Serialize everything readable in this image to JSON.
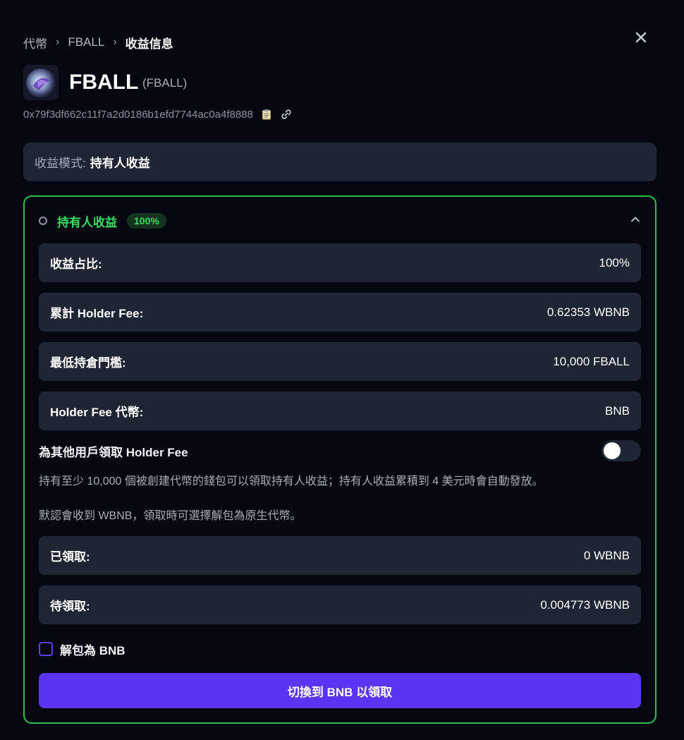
{
  "breadcrumb": {
    "items": [
      "代幣",
      "FBALL"
    ],
    "current": "收益信息",
    "separator": "›"
  },
  "token": {
    "name": "FBALL",
    "symbol": "(FBALL)",
    "address": "0x79f3df662c11f7a2d0186b1efd7744ac0a4f8888",
    "logo_icon": "token-logo-image"
  },
  "mode": {
    "label": "收益模式:",
    "value": "持有人收益"
  },
  "panel": {
    "title": "持有人收益",
    "badge": "100%",
    "rows_top": [
      {
        "key": "收益占比:",
        "value": "100%"
      },
      {
        "key": "累計 Holder Fee:",
        "value": "0.62353 WBNB"
      },
      {
        "key": "最低持倉門檻:",
        "value": "10,000 FBALL"
      },
      {
        "key": "Holder Fee 代幣:",
        "value": "BNB"
      }
    ],
    "toggle_label": "為其他用戶領取 Holder Fee",
    "toggle_on": false,
    "desc1": "持有至少 10,000 個被創建代幣的錢包可以領取持有人收益；持有人收益累積到 4 美元時會自動發放。",
    "desc2": "默認會收到 WBNB，領取時可選擇解包為原生代幣。",
    "rows_bottom": [
      {
        "key": "已領取:",
        "value": "0 WBNB"
      },
      {
        "key": "待領取:",
        "value": "0.004773 WBNB"
      }
    ],
    "checkbox_label": "解包為 BNB",
    "checkbox_checked": false,
    "action_label": "切換到 BNB 以領取"
  },
  "colors": {
    "accent_green": "#3ddc62",
    "border_green": "#2fbf4f",
    "button_purple": "#5b34f5",
    "row_bg": "#1f2633"
  }
}
